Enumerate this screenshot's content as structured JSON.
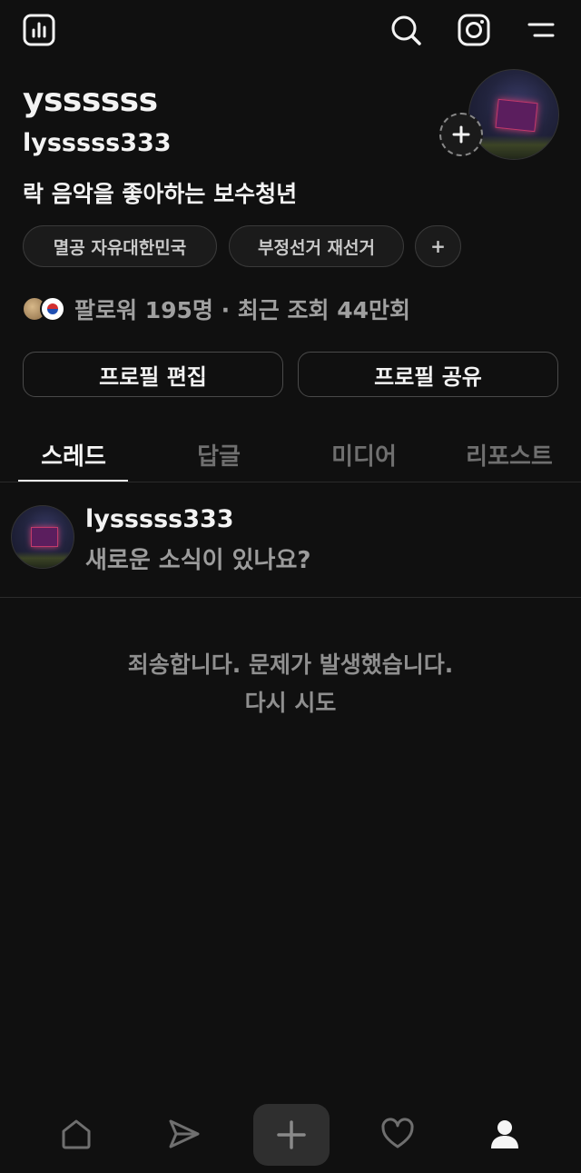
{
  "header": {
    "icons": [
      "insights-icon",
      "search-icon",
      "instagram-icon",
      "menu-icon"
    ]
  },
  "profile": {
    "name": "yssssss",
    "handle": "lysssss333",
    "bio": "락 음악을 좋아하는 보수청년",
    "chips": [
      "멸공 자유대한민국",
      "부정선거 재선거",
      "+"
    ],
    "followers_text": "팔로워 195명 · 최근 조회 44만회"
  },
  "actions": {
    "edit_profile": "프로필 편집",
    "share_profile": "프로필 공유"
  },
  "tabs": [
    {
      "label": "스레드",
      "active": true
    },
    {
      "label": "답글",
      "active": false
    },
    {
      "label": "미디어",
      "active": false
    },
    {
      "label": "리포스트",
      "active": false
    }
  ],
  "composer": {
    "name": "lysssss333",
    "prompt": "새로운 소식이 있나요?"
  },
  "error": {
    "message": "죄송합니다. 문제가 발생했습니다.",
    "retry": "다시 시도"
  },
  "bottom_nav": [
    "home-icon",
    "send-icon",
    "plus-icon",
    "heart-icon",
    "profile-icon"
  ],
  "colors": {
    "background": "#101010",
    "text": "#f3f3f3",
    "muted": "#8f8f8f"
  }
}
